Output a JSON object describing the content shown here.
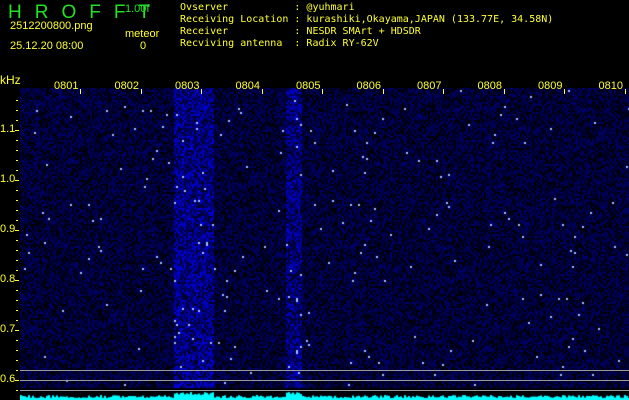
{
  "header": {
    "logo": "HROFFT",
    "version": "1.00f",
    "filename": "2512200800.png",
    "datetime": "25.12.20 08:00",
    "meteor_label": "meteor",
    "meteor_count": "0"
  },
  "info": [
    {
      "label": "Ovserver           ",
      "value": ": @yuhmari"
    },
    {
      "label": "Receiving Location ",
      "value": ": kurashiki,Okayama,JAPAN (133.77E, 34.58N)"
    },
    {
      "label": "Receiver           ",
      "value": ": NESDR SMArt + HDSDR"
    },
    {
      "label": "Recviving antenna  ",
      "value": ": Radix RY-62V"
    }
  ],
  "axis": {
    "y_unit": "kHz",
    "y_labels": [
      "1.1",
      "1.0",
      "0.9",
      "0.8",
      "0.7",
      "0.6"
    ],
    "x_labels": [
      "0801",
      "0802",
      "0803",
      "0804",
      "0805",
      "0806",
      "0807",
      "0808",
      "0809",
      "0810"
    ]
  },
  "colors": {
    "accent_green": "#22e022",
    "text_yellow": "#ffff33",
    "signal": "#2020ff",
    "level": "#00ffff"
  }
}
